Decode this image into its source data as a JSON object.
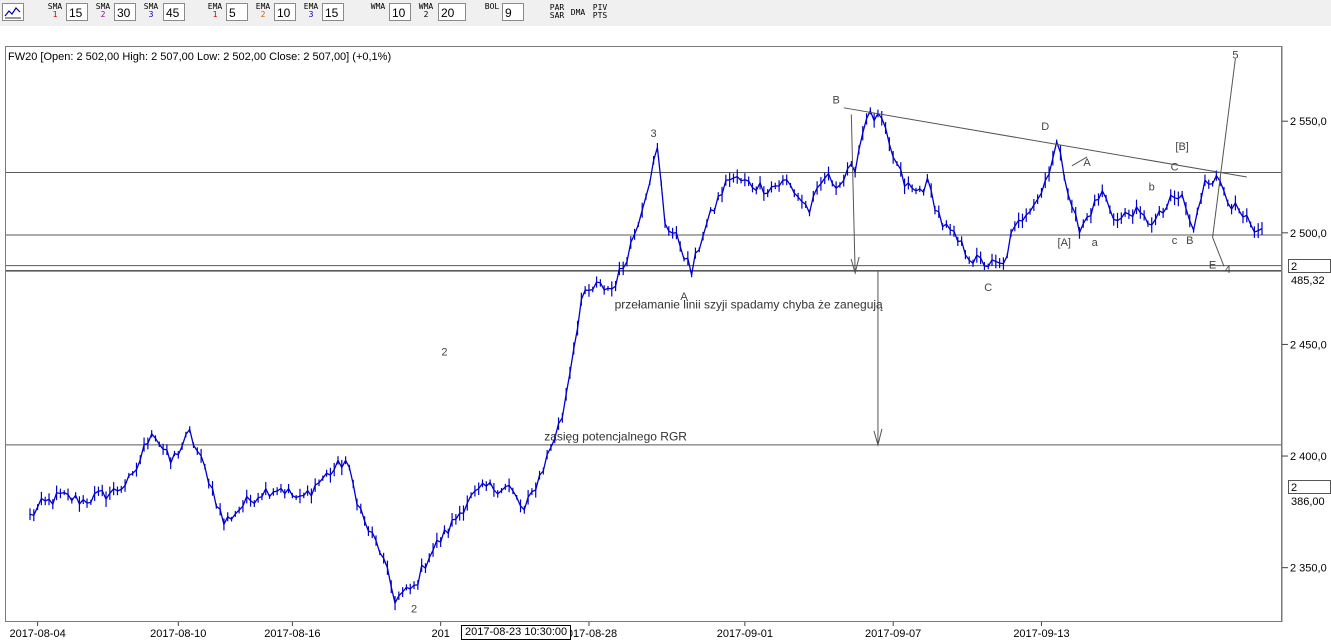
{
  "toolbar": {
    "indicators": [
      {
        "name": "SMA",
        "index": "1",
        "value": "15",
        "color": "#cc0000"
      },
      {
        "name": "SMA",
        "index": "2",
        "value": "30",
        "color": "#990099"
      },
      {
        "name": "SMA",
        "index": "3",
        "value": "45",
        "color": "#0000cc"
      },
      {
        "name": "EMA",
        "index": "1",
        "value": "5",
        "color": "#cc0000"
      },
      {
        "name": "EMA",
        "index": "2",
        "value": "10",
        "color": "#cc6600"
      },
      {
        "name": "EMA",
        "index": "3",
        "value": "15",
        "color": "#0000cc"
      },
      {
        "name": "WMA",
        "index": "",
        "value": "10",
        "color": "#000000"
      },
      {
        "name": "WMA",
        "index": "2",
        "value": "20",
        "color": "#000000"
      },
      {
        "name": "BOL",
        "index": "",
        "value": "9",
        "color": "#000000"
      }
    ],
    "buttons": [
      {
        "top": "PAR",
        "bottom": "SAR"
      },
      {
        "top": "DMA",
        "bottom": ""
      },
      {
        "top": "PIV",
        "bottom": "PTS"
      }
    ]
  },
  "header": {
    "ohlc": "FW20 [Open: 2 502,00  High: 2 507,00  Low: 2 502,00  Close: 2 507,00] (+0,1%)"
  },
  "crosshair": {
    "label": "2017-08-23 10:30:00"
  },
  "colors": {
    "price": "#0000cc",
    "lines": "#555555",
    "labels": "#444444"
  },
  "chart_data": {
    "type": "line",
    "symbol": "FW20",
    "x_tick_labels": [
      "2017-08-04",
      "2017-08-10",
      "2017-08-16",
      "201",
      "2017-08-28",
      "2017-09-01",
      "2017-09-07",
      "2017-09-13"
    ],
    "x_tick_index": [
      2,
      39,
      69,
      108,
      147,
      188,
      227,
      266
    ],
    "y_ticks": [
      "2 350,0",
      "2 400,0",
      "2 450,0",
      "2 500,0",
      "2 550,0"
    ],
    "y_tick_values": [
      2350,
      2400,
      2450,
      2500,
      2550
    ],
    "ylim": [
      2327,
      2581
    ],
    "n_bars": 325,
    "price_anchors": [
      [
        0,
        2373
      ],
      [
        3,
        2378
      ],
      [
        8,
        2382
      ],
      [
        14,
        2380
      ],
      [
        22,
        2384
      ],
      [
        27,
        2390
      ],
      [
        32,
        2412
      ],
      [
        37,
        2397
      ],
      [
        42,
        2410
      ],
      [
        47,
        2390
      ],
      [
        51,
        2370
      ],
      [
        56,
        2378
      ],
      [
        61,
        2384
      ],
      [
        66,
        2386
      ],
      [
        71,
        2380
      ],
      [
        77,
        2390
      ],
      [
        83,
        2398
      ],
      [
        88,
        2370
      ],
      [
        92,
        2358
      ],
      [
        96,
        2336
      ],
      [
        101,
        2341
      ],
      [
        105,
        2356
      ],
      [
        110,
        2367
      ],
      [
        115,
        2380
      ],
      [
        120,
        2386
      ],
      [
        126,
        2386
      ],
      [
        130,
        2375
      ],
      [
        135,
        2395
      ],
      [
        140,
        2418
      ],
      [
        145,
        2470
      ],
      [
        149,
        2476
      ],
      [
        153,
        2475
      ],
      [
        156,
        2485
      ],
      [
        159,
        2500
      ],
      [
        165,
        2537
      ],
      [
        167,
        2505
      ],
      [
        171,
        2495
      ],
      [
        174,
        2482
      ],
      [
        177,
        2500
      ],
      [
        181,
        2515
      ],
      [
        184,
        2525
      ],
      [
        189,
        2522
      ],
      [
        194,
        2520
      ],
      [
        199,
        2523
      ],
      [
        205,
        2510
      ],
      [
        209,
        2525
      ],
      [
        213,
        2522
      ],
      [
        217,
        2530
      ],
      [
        220,
        2553
      ],
      [
        224,
        2550
      ],
      [
        226,
        2538
      ],
      [
        230,
        2522
      ],
      [
        233,
        2518
      ],
      [
        236,
        2522
      ],
      [
        240,
        2504
      ],
      [
        244,
        2496
      ],
      [
        248,
        2488
      ],
      [
        252,
        2486
      ],
      [
        256,
        2485
      ],
      [
        258,
        2498
      ],
      [
        262,
        2510
      ],
      [
        266,
        2518
      ],
      [
        270,
        2540
      ],
      [
        273,
        2520
      ],
      [
        276,
        2500
      ],
      [
        279,
        2510
      ],
      [
        282,
        2518
      ],
      [
        286,
        2505
      ],
      [
        290,
        2510
      ],
      [
        293,
        2506
      ],
      [
        296,
        2505
      ],
      [
        300,
        2514
      ],
      [
        303,
        2516
      ],
      [
        306,
        2500
      ],
      [
        309,
        2525
      ],
      [
        313,
        2523
      ],
      [
        316,
        2513
      ],
      [
        318,
        2508
      ],
      [
        320,
        2505
      ],
      [
        322,
        2499
      ]
    ],
    "horizontal_levels": [
      2527,
      2499,
      2485.32,
      2483,
      2405
    ],
    "badges": [
      {
        "text": "2 485,32",
        "value": 2485.32
      },
      {
        "text": "2 386,00",
        "value": 2386
      }
    ],
    "annotations": {
      "wave_labels": [
        {
          "text": "2",
          "i": 109,
          "v": 2445
        },
        {
          "text": "2",
          "i": 101,
          "v": 2330
        },
        {
          "text": "3",
          "i": 164,
          "v": 2543
        },
        {
          "text": "A",
          "i": 172,
          "v": 2470
        },
        {
          "text": "B",
          "i": 212,
          "v": 2558
        },
        {
          "text": "C",
          "i": 252,
          "v": 2474
        },
        {
          "text": "D",
          "i": 267,
          "v": 2546
        },
        {
          "text": "A",
          "i": 278,
          "v": 2530
        },
        {
          "text": "[A]",
          "i": 272,
          "v": 2494
        },
        {
          "text": "a",
          "i": 280,
          "v": 2494
        },
        {
          "text": "b",
          "i": 295,
          "v": 2519
        },
        {
          "text": "c",
          "i": 301,
          "v": 2495
        },
        {
          "text": "B",
          "i": 305,
          "v": 2495
        },
        {
          "text": "[B]",
          "i": 303,
          "v": 2537
        },
        {
          "text": "C",
          "i": 301,
          "v": 2528
        },
        {
          "text": "E",
          "i": 311,
          "v": 2484
        },
        {
          "text": "4",
          "i": 315,
          "v": 2482
        },
        {
          "text": "5",
          "i": 317,
          "v": 2578
        }
      ],
      "texts": [
        {
          "text": "przełamanie linii szyji spadamy chyba że zanegują",
          "i": 189,
          "v": 2466
        },
        {
          "text": "zasięg potencjalnego RGR",
          "i": 154,
          "v": 2407
        }
      ],
      "lines": [
        [
          [
            214,
            2556
          ],
          [
            320,
            2525
          ]
        ],
        [
          [
            216,
            2553
          ],
          [
            217,
            2482
          ]
        ],
        [
          [
            223,
            2483
          ],
          [
            223,
            2405
          ]
        ],
        [
          [
            311,
            2498
          ],
          [
            317,
            2578
          ]
        ],
        [
          [
            311,
            2498
          ],
          [
            314,
            2485
          ]
        ],
        [
          [
            274,
            2530
          ],
          [
            278,
            2534
          ]
        ]
      ]
    }
  }
}
